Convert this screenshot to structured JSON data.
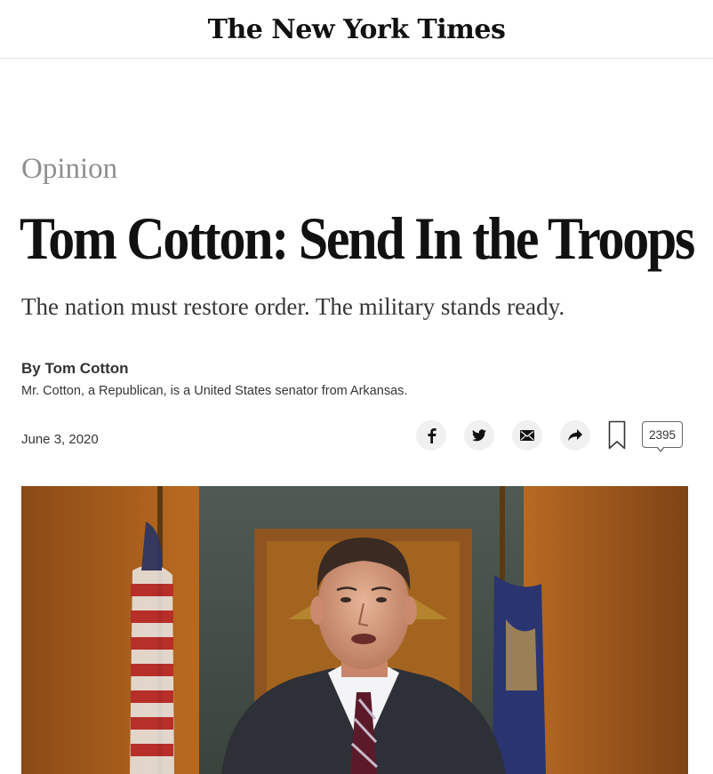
{
  "header": {
    "logo_text": "The New York Times"
  },
  "article": {
    "kicker": "Opinion",
    "headline": "Tom Cotton: Send In the Troops",
    "summary": "The nation must restore order. The military stands ready.",
    "byline": "By Tom Cotton",
    "author_bio": "Mr. Cotton, a Republican, is a United States senator from Arkansas.",
    "date": "June 3, 2020"
  },
  "share_tools": {
    "icons": [
      "facebook-icon",
      "twitter-icon",
      "email-icon",
      "share-arrow-icon",
      "bookmark-icon",
      "comment-icon"
    ],
    "comment_count": "2395"
  },
  "colors": {
    "text": "#121212",
    "kicker": "#8f8f8f",
    "divider": "#e2e2e2",
    "share_button_bg": "#f0f0f0"
  }
}
